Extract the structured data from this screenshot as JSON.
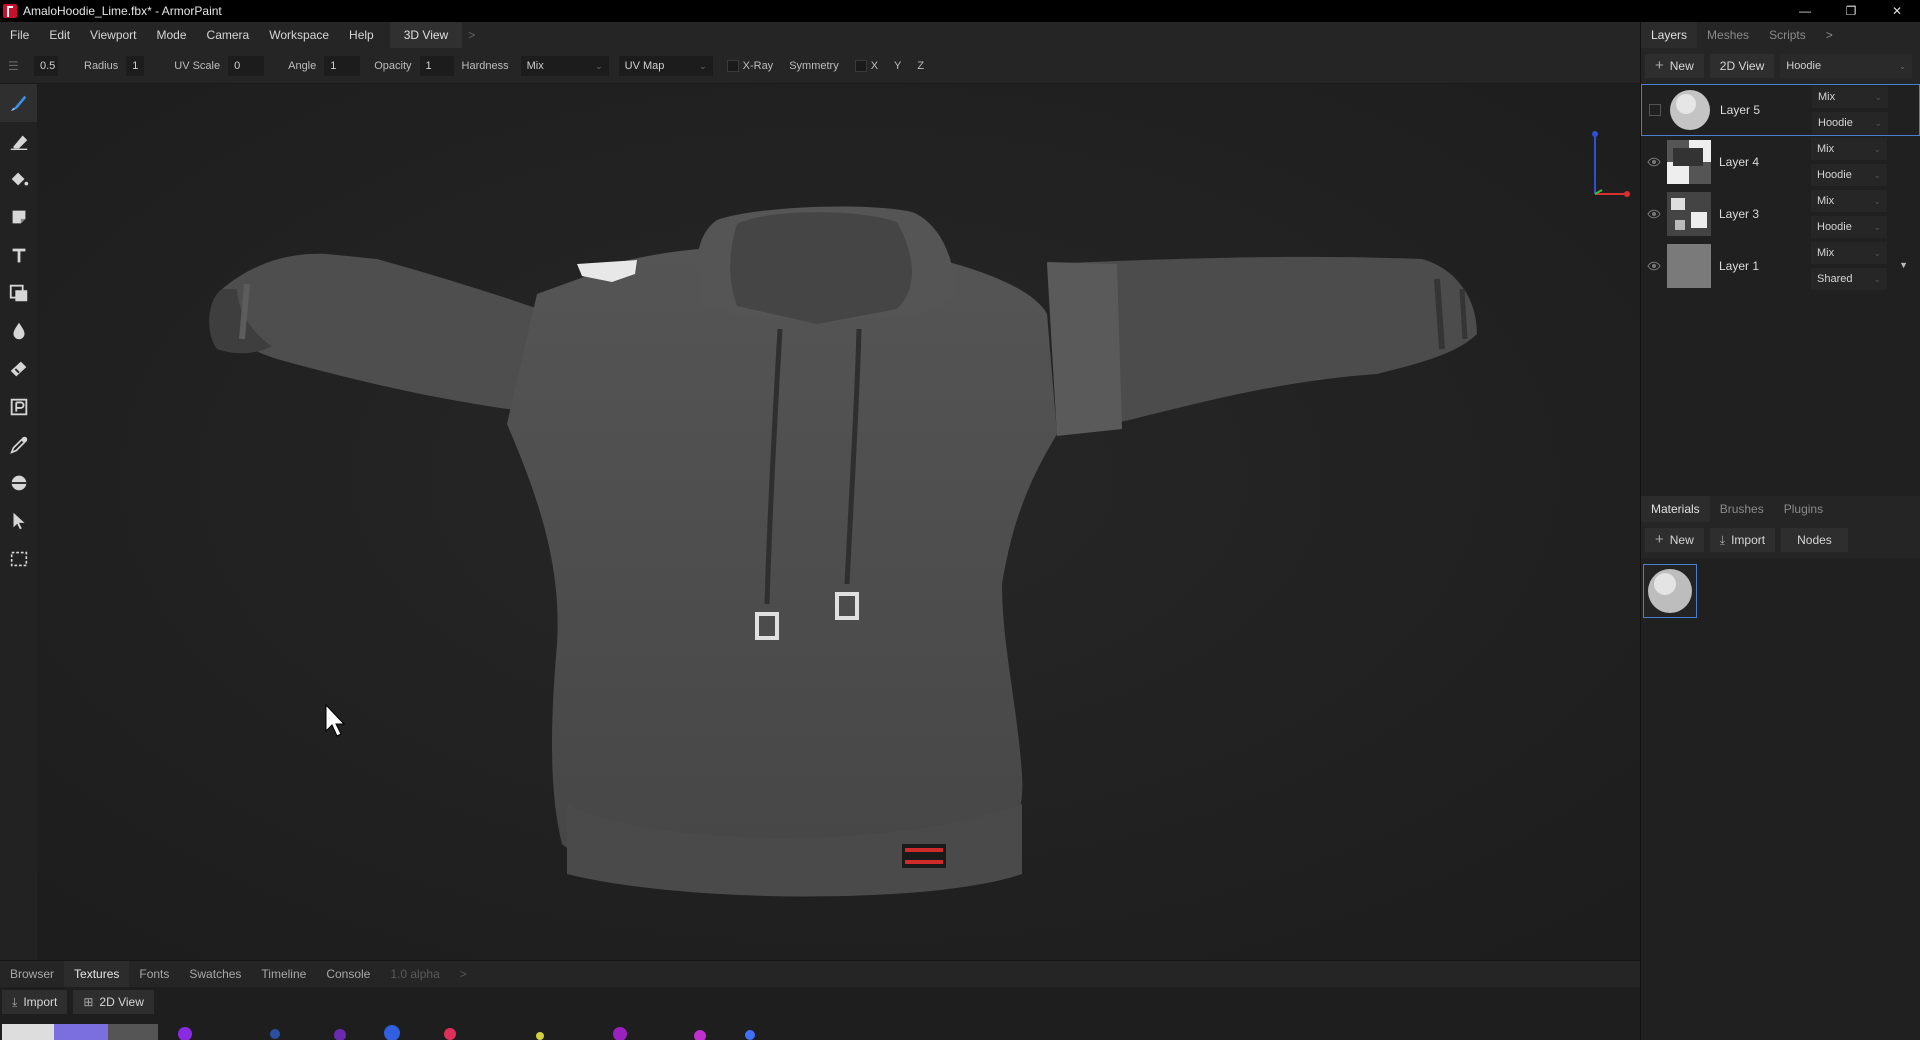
{
  "window": {
    "title": "AmaloHoodie_Lime.fbx* - ArmorPaint",
    "controls": [
      "—",
      "❐",
      "✕"
    ]
  },
  "menu": {
    "items": [
      "File",
      "Edit",
      "Viewport",
      "Mode",
      "Camera",
      "Workspace",
      "Help"
    ],
    "active_tab": "3D View",
    "more": ">"
  },
  "toolbar": {
    "brush_size": "0.5",
    "radius_label": "Radius",
    "radius_value": "1",
    "uvscale_label": "UV Scale",
    "uvscale_value": "0",
    "angle_label": "Angle",
    "angle_value": "1",
    "opacity_label": "Opacity",
    "opacity_value": "1",
    "hardness_label": "Hardness",
    "blend_value": "Mix",
    "uv_map_value": "UV Map",
    "xray_label": "X-Ray",
    "symmetry_label": "Symmetry",
    "x_label": "X",
    "y_label": "Y",
    "z_label": "Z"
  },
  "tools": [
    {
      "name": "brush-icon",
      "active": true
    },
    {
      "name": "eraser-icon"
    },
    {
      "name": "fill-icon"
    },
    {
      "name": "decal-icon"
    },
    {
      "name": "text-icon"
    },
    {
      "name": "clone-icon"
    },
    {
      "name": "blur-icon"
    },
    {
      "name": "smudge-icon"
    },
    {
      "name": "particle-icon"
    },
    {
      "name": "colorpicker-icon"
    },
    {
      "name": "bake-icon"
    },
    {
      "name": "picker-icon"
    },
    {
      "name": "select-rect-icon"
    }
  ],
  "right_panel": {
    "tabs": [
      "Layers",
      "Meshes",
      "Scripts",
      ">"
    ],
    "new_label": "New",
    "view_label": "2D View",
    "object_value": "Hoodie",
    "layers": [
      {
        "name": "Layer 5",
        "blend": "Mix",
        "mask": "Hoodie",
        "selected": true
      },
      {
        "name": "Layer 4",
        "blend": "Mix",
        "mask": "Hoodie"
      },
      {
        "name": "Layer 3",
        "blend": "Mix",
        "mask": "Hoodie"
      },
      {
        "name": "Layer 1",
        "blend": "Mix",
        "mask": "Shared"
      }
    ],
    "lower_tabs": [
      "Materials",
      "Brushes",
      "Plugins"
    ],
    "mat_new": "New",
    "mat_import": "Import",
    "mat_nodes": "Nodes"
  },
  "bottom_panel": {
    "tabs": [
      "Browser",
      "Textures",
      "Fonts",
      "Swatches",
      "Timeline",
      "Console"
    ],
    "version": "1.0 alpha",
    "more": ">",
    "import_label": "Import",
    "view_label": "2D View"
  },
  "colors": {
    "accent": "#4a7fd1",
    "brand": "#c8102e",
    "hoodie": "#4d4d4d"
  }
}
